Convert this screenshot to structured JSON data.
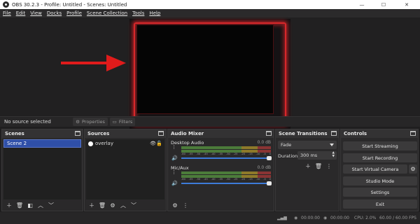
{
  "window": {
    "title": "OBS 30.2.3 - Profile: Untitled - Scenes: Untitled",
    "controls": [
      "—",
      "☐",
      "✕"
    ]
  },
  "menu": [
    "File",
    "Edit",
    "View",
    "Docks",
    "Profile",
    "Scene Collection",
    "Tools",
    "Help"
  ],
  "source_bar": {
    "no_source": "No source selected",
    "properties": "Properties",
    "filters": "Filters"
  },
  "docks": {
    "scenes": {
      "title": "Scenes",
      "items": [
        "Scene 2"
      ]
    },
    "sources": {
      "title": "Sources",
      "items": [
        "overlay"
      ]
    },
    "mixer": {
      "title": "Audio Mixer",
      "ticks": [
        "-60",
        "-55",
        "-50",
        "-45",
        "-40",
        "-35",
        "-30",
        "-25",
        "-20",
        "-15",
        "-10",
        "-5",
        "0"
      ],
      "channels": [
        {
          "name": "Desktop Audio",
          "db": "0.0 dB",
          "volume": 1.0
        },
        {
          "name": "Mic/Aux",
          "db": "0.0 dB",
          "volume": 1.0
        }
      ]
    },
    "transitions": {
      "title": "Scene Transitions",
      "selected": "Fade",
      "duration_label": "Duration",
      "duration_value": "300 ms"
    },
    "controls": {
      "title": "Controls",
      "buttons": [
        "Start Streaming",
        "Start Recording",
        "Start Virtual Camera",
        "Studio Mode",
        "Settings",
        "Exit"
      ]
    }
  },
  "status": {
    "rec_time": "00:00:00",
    "stream_time": "00:00:00",
    "cpu": "CPU: 2.0%",
    "fps": "60.00 / 60.00 FPS"
  },
  "colors": {
    "accent": "#2f4fa8",
    "frame_red": "#d7272a",
    "arrow_red": "#e01b1b"
  }
}
